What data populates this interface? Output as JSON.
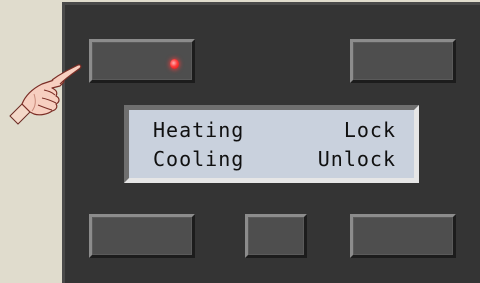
{
  "display": {
    "row1": {
      "left": "Heating",
      "right": "Lock"
    },
    "row2": {
      "left": "Cooling",
      "right": "Unlock"
    }
  },
  "buttons": [
    {
      "id": "top-left",
      "indicator": "led-on"
    },
    {
      "id": "top-right"
    },
    {
      "id": "bottom-left"
    },
    {
      "id": "bottom-center"
    },
    {
      "id": "bottom-right"
    }
  ],
  "colors": {
    "background": "#e0dccd",
    "panel": "#343434",
    "button": "#4e4e4e",
    "led": "#ff3b3b",
    "lcd": "#c9d1dd"
  },
  "icons": [
    "pointing-hand-icon",
    "led-indicator-icon"
  ]
}
